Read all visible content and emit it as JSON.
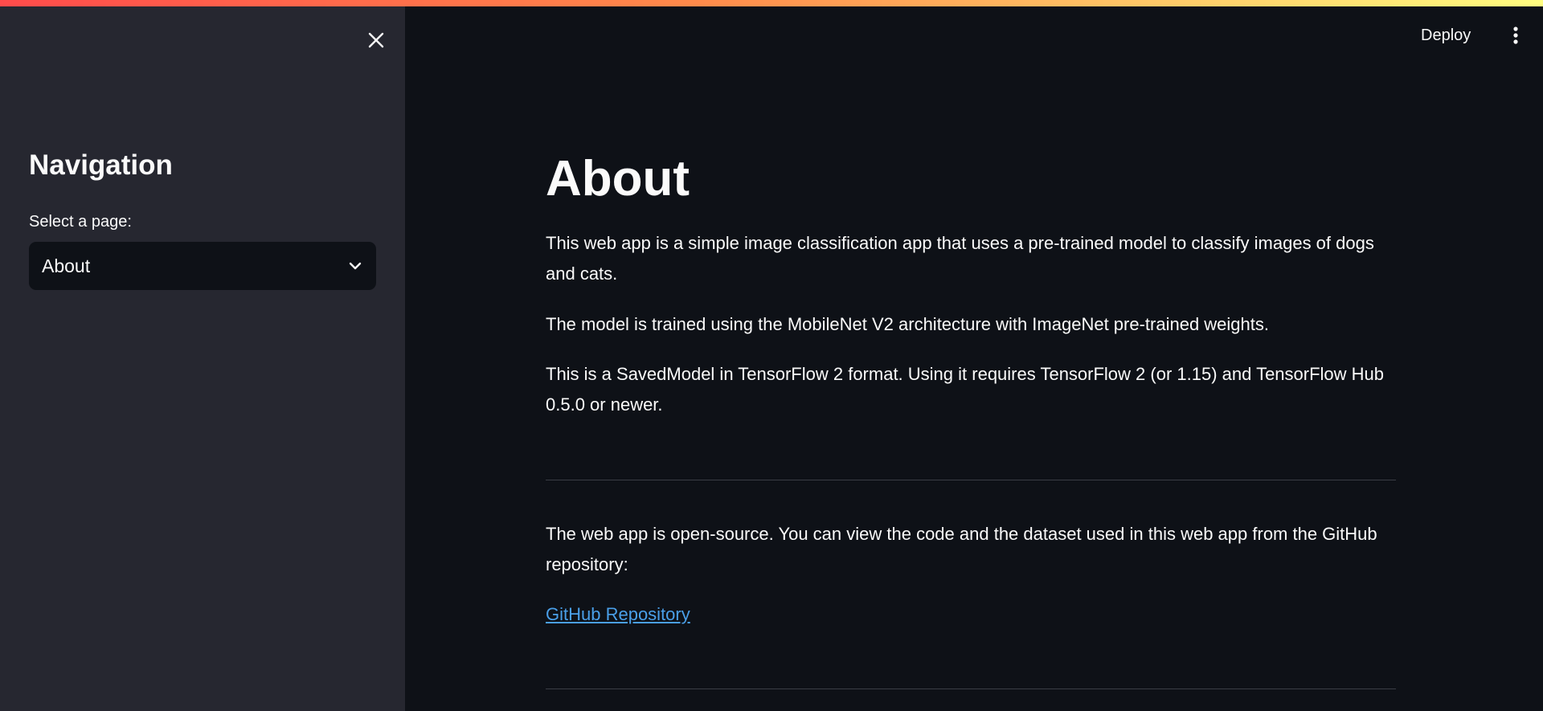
{
  "sidebar": {
    "title": "Navigation",
    "select_label": "Select a page:",
    "selected_page": "About",
    "close_icon": "close-icon",
    "chevron_icon": "chevron-down-icon"
  },
  "header": {
    "deploy_label": "Deploy",
    "menu_icon": "more-vertical-icon"
  },
  "main": {
    "title": "About",
    "paragraphs": [
      "This web app is a simple image classification app that uses a pre-trained model to classify images of dogs and cats.",
      "The model is trained using the MobileNet V2 architecture with ImageNet pre-trained weights.",
      "This is a SavedModel in TensorFlow 2 format. Using it requires TensorFlow 2 (or 1.15) and TensorFlow Hub 0.5.0 or newer.",
      "The web app is open-source. You can view the code and the dataset used in this web app from the GitHub repository:"
    ],
    "link_label": "GitHub Repository"
  },
  "colors": {
    "background": "#0e1117",
    "sidebar": "#262730",
    "link": "#4a9fe8",
    "accent_start": "#ff4b4b",
    "accent_end": "#fffd80"
  }
}
